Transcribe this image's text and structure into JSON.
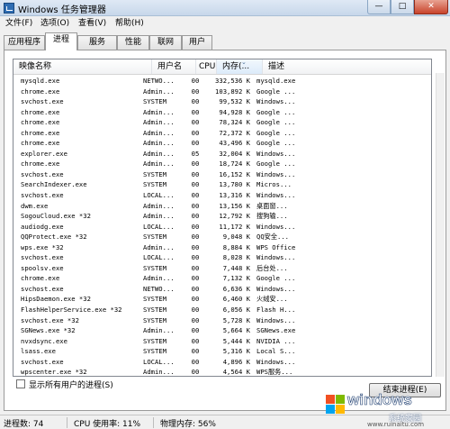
{
  "window": {
    "title": "Windows 任务管理器",
    "icon": "task-manager-icon",
    "controls": {
      "minimize": "—",
      "maximize": "□",
      "close": "✕"
    }
  },
  "menu": [
    "文件(F)",
    "选项(O)",
    "查看(V)",
    "帮助(H)"
  ],
  "tabs": [
    "应用程序",
    "进程",
    "服务",
    "性能",
    "联网",
    "用户"
  ],
  "active_tab": "进程",
  "columns": {
    "name": "映像名称",
    "user": "用户名",
    "cpu": "CPU",
    "memory": "内存(...",
    "description": "描述"
  },
  "processes": [
    [
      "mysqld.exe",
      "NETWO...",
      "00",
      "332,536 K",
      "mysqld.exe"
    ],
    [
      "chrome.exe",
      "Admin...",
      "00",
      "103,892 K",
      "Google ..."
    ],
    [
      "svchost.exe",
      "SYSTEM",
      "00",
      "99,532 K",
      "Windows..."
    ],
    [
      "chrome.exe",
      "Admin...",
      "00",
      "94,928 K",
      "Google ..."
    ],
    [
      "chrome.exe",
      "Admin...",
      "00",
      "78,324 K",
      "Google ..."
    ],
    [
      "chrome.exe",
      "Admin...",
      "00",
      "72,372 K",
      "Google ..."
    ],
    [
      "chrome.exe",
      "Admin...",
      "00",
      "43,496 K",
      "Google ..."
    ],
    [
      "explorer.exe",
      "Admin...",
      "05",
      "32,004 K",
      "Windows..."
    ],
    [
      "chrome.exe",
      "Admin...",
      "00",
      "18,724 K",
      "Google ..."
    ],
    [
      "svchost.exe",
      "SYSTEM",
      "00",
      "16,152 K",
      "Windows..."
    ],
    [
      "SearchIndexer.exe",
      "SYSTEM",
      "00",
      "13,780 K",
      "Micros..."
    ],
    [
      "svchost.exe",
      "LOCAL...",
      "00",
      "13,316 K",
      "Windows..."
    ],
    [
      "dwm.exe",
      "Admin...",
      "00",
      "13,156 K",
      "桌面窗..."
    ],
    [
      "SogouCloud.exe *32",
      "Admin...",
      "00",
      "12,792 K",
      "搜狗输..."
    ],
    [
      "audiodg.exe",
      "LOCAL...",
      "00",
      "11,172 K",
      "Windows..."
    ],
    [
      "QQProtect.exe *32",
      "SYSTEM",
      "00",
      "9,048 K",
      "QQ安全..."
    ],
    [
      "wps.exe *32",
      "Admin...",
      "00",
      "8,884 K",
      "WPS Office"
    ],
    [
      "svchost.exe",
      "LOCAL...",
      "00",
      "8,028 K",
      "Windows..."
    ],
    [
      "spoolsv.exe",
      "SYSTEM",
      "00",
      "7,448 K",
      "后台处..."
    ],
    [
      "chrome.exe",
      "Admin...",
      "00",
      "7,132 K",
      "Google ..."
    ],
    [
      "svchost.exe",
      "NETWO...",
      "00",
      "6,636 K",
      "Windows..."
    ],
    [
      "HipsDaemon.exe *32",
      "SYSTEM",
      "00",
      "6,460 K",
      "火绒安..."
    ],
    [
      "FlashHelperService.exe *32",
      "SYSTEM",
      "00",
      "6,056 K",
      "Flash H..."
    ],
    [
      "svchost.exe *32",
      "SYSTEM",
      "00",
      "5,728 K",
      "Windows..."
    ],
    [
      "SGNews.exe *32",
      "Admin...",
      "00",
      "5,664 K",
      "SGNews.exe"
    ],
    [
      "nvxdsync.exe",
      "SYSTEM",
      "00",
      "5,444 K",
      "NVIDIA ..."
    ],
    [
      "lsass.exe",
      "SYSTEM",
      "00",
      "5,316 K",
      "Local S..."
    ],
    [
      "svchost.exe",
      "LOCAL...",
      "00",
      "4,896 K",
      "Windows..."
    ],
    [
      "wpscenter.exe *32",
      "Admin...",
      "00",
      "4,564 K",
      "WPS服务..."
    ]
  ],
  "show_all_users_label": "显示所有用户的进程(S)",
  "end_process_label": "结束进程(E)",
  "status": {
    "process_count": "进程数: 74",
    "cpu_usage": "CPU 使用率: 11%",
    "physical_memory": "物理内存: 56%"
  },
  "watermark": {
    "brand": "windows",
    "sub": "系统家园",
    "url": "www.ruinaitu.com",
    "logo_colors": [
      "#f25022",
      "#7fba00",
      "#00a4ef",
      "#ffb900"
    ]
  }
}
